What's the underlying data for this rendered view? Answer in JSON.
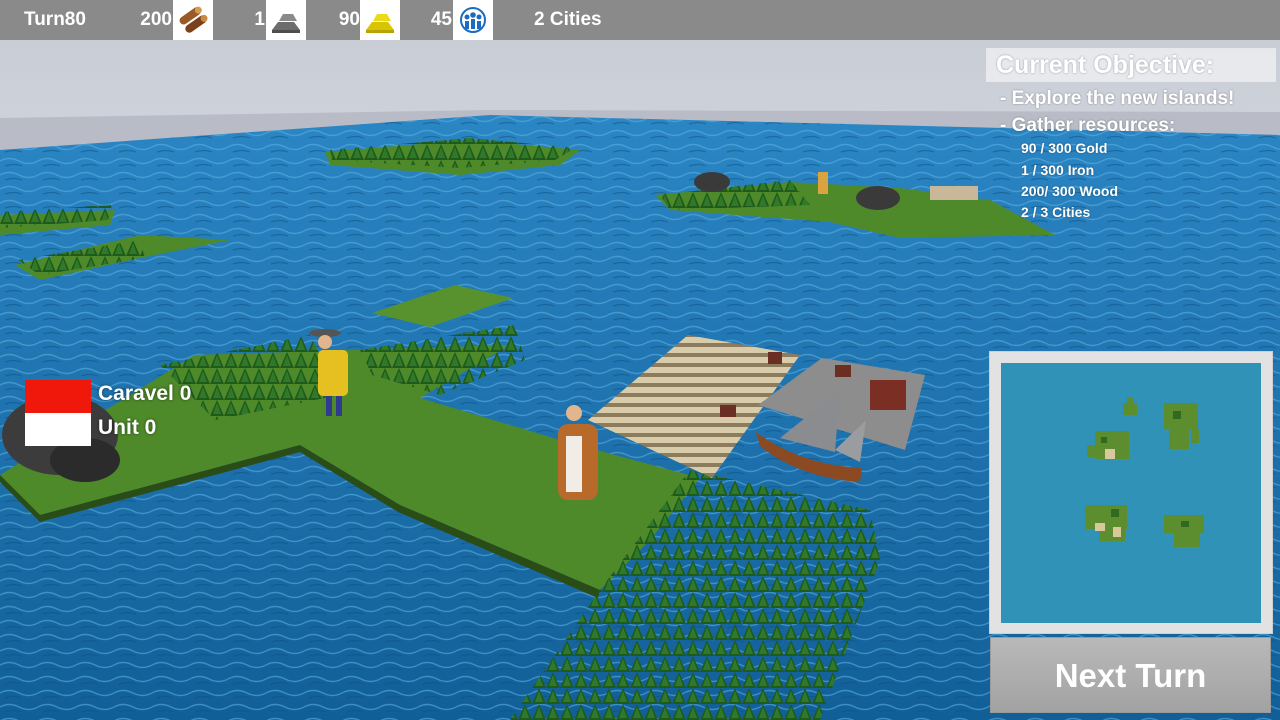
{
  "topbar": {
    "turn": "Turn80",
    "wood": "200",
    "iron": "1",
    "gold": "90",
    "population": "45",
    "cities": "2  Cities",
    "icons": [
      "wood-logs-icon",
      "iron-ingot-icon",
      "gold-ingot-icon",
      "population-icon"
    ]
  },
  "objective": {
    "title": "Current Objective:",
    "explore": "- Explore the new islands!",
    "gather": "- Gather resources:",
    "gold": "90   / 300 Gold",
    "iron": "1     / 300 Iron",
    "wood": "200/ 300 Wood",
    "cities": "2     / 3 Cities"
  },
  "legend": {
    "caravel": "Caravel 0",
    "unit": "Unit 0",
    "caravel_color": "#f0180a",
    "unit_color": "#ffffff"
  },
  "buttons": {
    "next_turn": "Next Turn"
  },
  "colors": {
    "topbar": "#8a8a8a",
    "ocean": "#1b6fa6",
    "grass": "#4f8a2a",
    "forest": "#1f5a1c",
    "minimap_water": "#2f92b6"
  }
}
